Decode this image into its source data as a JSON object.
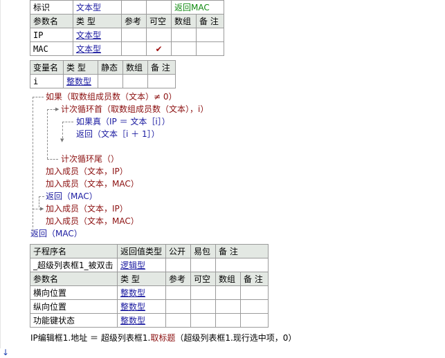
{
  "table_params1": {
    "row_biaoshi": {
      "name": "标识",
      "type": "文本型",
      "ref": "",
      "nullable": "",
      "note": "返回MAC"
    },
    "header": [
      "参数名",
      "类 型",
      "参考",
      "可空",
      "数组",
      "备 注"
    ],
    "rows": [
      {
        "name": "IP",
        "type": "文本型",
        "ref": "",
        "nullable": ""
      },
      {
        "name": "MAC",
        "type": "文本型",
        "ref": "",
        "nullable": "✔"
      }
    ]
  },
  "table_vars": {
    "header": [
      "变量名",
      "类 型",
      "静态",
      "数组",
      "备 注"
    ],
    "rows": [
      {
        "name": "i",
        "type": "整数型"
      }
    ]
  },
  "code": {
    "line1": "如果（取数组成员数（文本）≠ 0）",
    "line2": "计次循环首（取数组成员数（文本），i）",
    "line3": "如果真（IP ＝ 文本［i］）",
    "line4": "返回（文本［i ＋ 1］）",
    "line5": "计次循环尾（）",
    "line6": "加入成员（文本，IP）",
    "line7": "加入成员（文本，MAC）",
    "line8": "返回（MAC）",
    "line9": "加入成员（文本，IP）",
    "line10": "加入成员（文本，MAC）",
    "line11": "返回（MAC）"
  },
  "table_sub": {
    "header": [
      "子程序名",
      "返回值类型",
      "公开",
      "易包",
      "备 注"
    ],
    "row": {
      "name": "_超级列表框1_被双击",
      "ret": "逻辑型"
    },
    "param_header": [
      "参数名",
      "类 型",
      "参考",
      "可空",
      "数组",
      "备 注"
    ],
    "params": [
      {
        "name": "横向位置",
        "type": "整数型"
      },
      {
        "name": "纵向位置",
        "type": "整数型"
      },
      {
        "name": "功能键状态",
        "type": "整数型"
      }
    ]
  },
  "bottom_line": {
    "prefix": "IP编辑框1.地址 ＝ 超级列表框1.",
    "method": "取标题",
    "suffix": "（超级列表框1.现行选中项，0）"
  }
}
